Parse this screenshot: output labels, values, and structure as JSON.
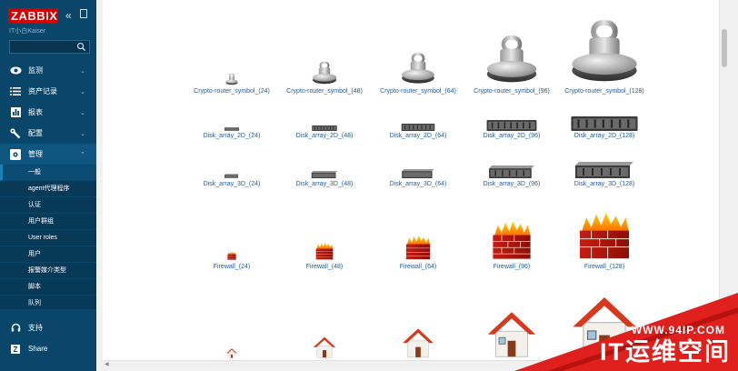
{
  "sidebar": {
    "logo": "ZABBIX",
    "server_name": "IT小白Kaiser",
    "search_placeholder": "",
    "menu": [
      {
        "label": "监测",
        "icon": "eye-icon"
      },
      {
        "label": "资产记录",
        "icon": "list-icon"
      },
      {
        "label": "报表",
        "icon": "bar-chart-icon"
      },
      {
        "label": "配置",
        "icon": "wrench-icon"
      },
      {
        "label": "管理",
        "icon": "gear-icon"
      }
    ],
    "submenu": [
      "一般",
      "agent代理程序",
      "认证",
      "用户群组",
      "User roles",
      "用户",
      "报警媒介类型",
      "脚本",
      "队列"
    ],
    "footer": [
      {
        "label": "支持",
        "icon": "headset-icon"
      },
      {
        "label": "Share",
        "icon": "share-icon"
      }
    ]
  },
  "gallery": {
    "rows": [
      [
        "Crypto-router_symbol_(24)",
        "Crypto-router_symbol_(48)",
        "Crypto-router_symbol_(64)",
        "Crypto-router_symbol_(96)",
        "Crypto-router_symbol_(128)"
      ],
      [
        "Disk_array_2D_(24)",
        "Disk_array_2D_(48)",
        "Disk_array_2D_(64)",
        "Disk_array_2D_(96)",
        "Disk_array_2D_(128)"
      ],
      [
        "Disk_array_3D_(24)",
        "Disk_array_3D_(48)",
        "Disk_array_3D_(64)",
        "Disk_array_3D_(96)",
        "Disk_array_3D_(128)"
      ],
      [
        "Firewall_(24)",
        "Firewall_(48)",
        "Firewall_(64)",
        "Firewall_(96)",
        "Firewall_(128)"
      ],
      [
        "",
        "",
        "",
        "",
        ""
      ]
    ]
  },
  "watermark": {
    "url": "WWW.94IP.COM",
    "main": "IT运维空间"
  },
  "colors": {
    "sidebar_bg": "#0a466a",
    "logo_red": "#d40000",
    "label_blue": "#1f5c99",
    "watermark_red": "#e0201c"
  }
}
